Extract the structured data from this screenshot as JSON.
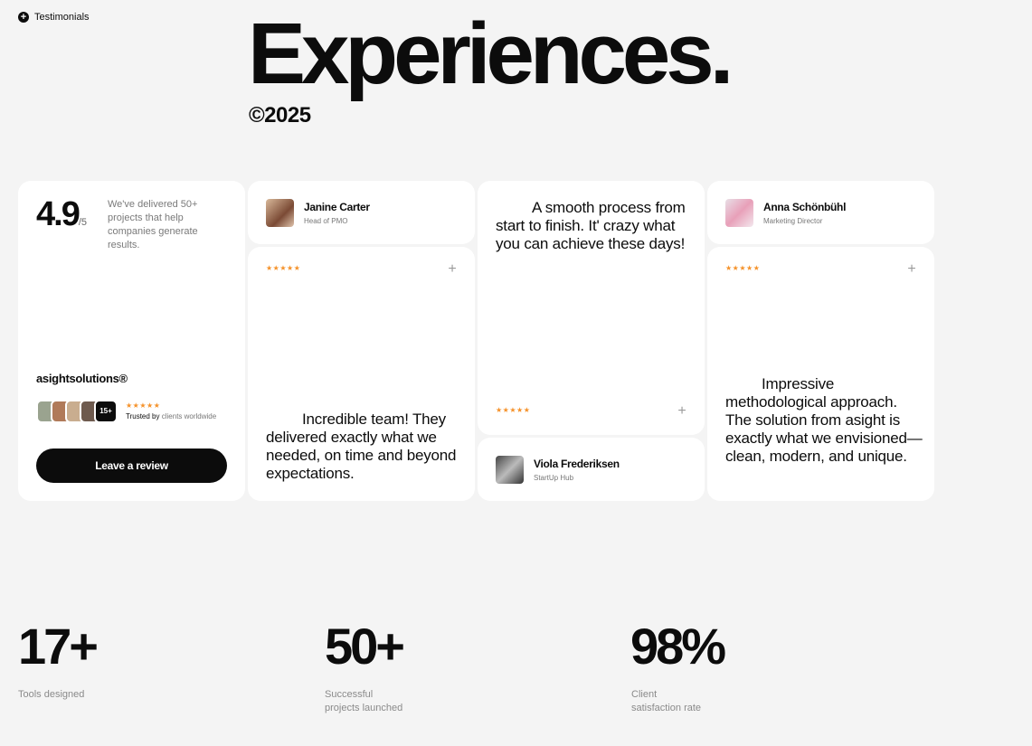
{
  "section": {
    "tag_label": "Testimonials",
    "tag_icon": "plus-circle-icon"
  },
  "hero": {
    "title": "Experiences.",
    "year": "©2025"
  },
  "rating_card": {
    "score": "4.9",
    "out_of": "/5",
    "description": "We've delivered 50+ projects that help companies generate results.",
    "brand": "asightsolutions®",
    "avatar_more": "15+",
    "stars": "★★★★★",
    "trusted_prefix": "Trusted by",
    "trusted_suffix": "clients worldwide",
    "button_label": "Leave a review"
  },
  "testimonials": [
    {
      "name": "Janine Carter",
      "role": "Head of PMO",
      "stars": "★★★★★",
      "quote": "Incredible team! They delivered exactly what we needed, on time and beyond expectations."
    },
    {
      "name": "Viola Frederiksen",
      "role": "StartUp Hub",
      "stars": "★★★★★",
      "quote": "A smooth process from start to finish. It' crazy what you can achieve these days!"
    },
    {
      "name": "Anna Schönbühl",
      "role": "Marketing Director",
      "stars": "★★★★★",
      "quote": "Impressive methodological approach. The solution from asight is exactly what we envisioned—clean, modern, and unique."
    }
  ],
  "stats": [
    {
      "value": "17+",
      "label_line1": "Tools designed",
      "label_line2": ""
    },
    {
      "value": "50+",
      "label_line1": "Successful",
      "label_line2": "projects launched"
    },
    {
      "value": "98%",
      "label_line1": "Client",
      "label_line2": "satisfaction rate"
    }
  ],
  "colors": {
    "accent_star": "#f5922a",
    "primary": "#0c0c0c",
    "background": "#f4f4f4",
    "card": "#ffffff"
  }
}
